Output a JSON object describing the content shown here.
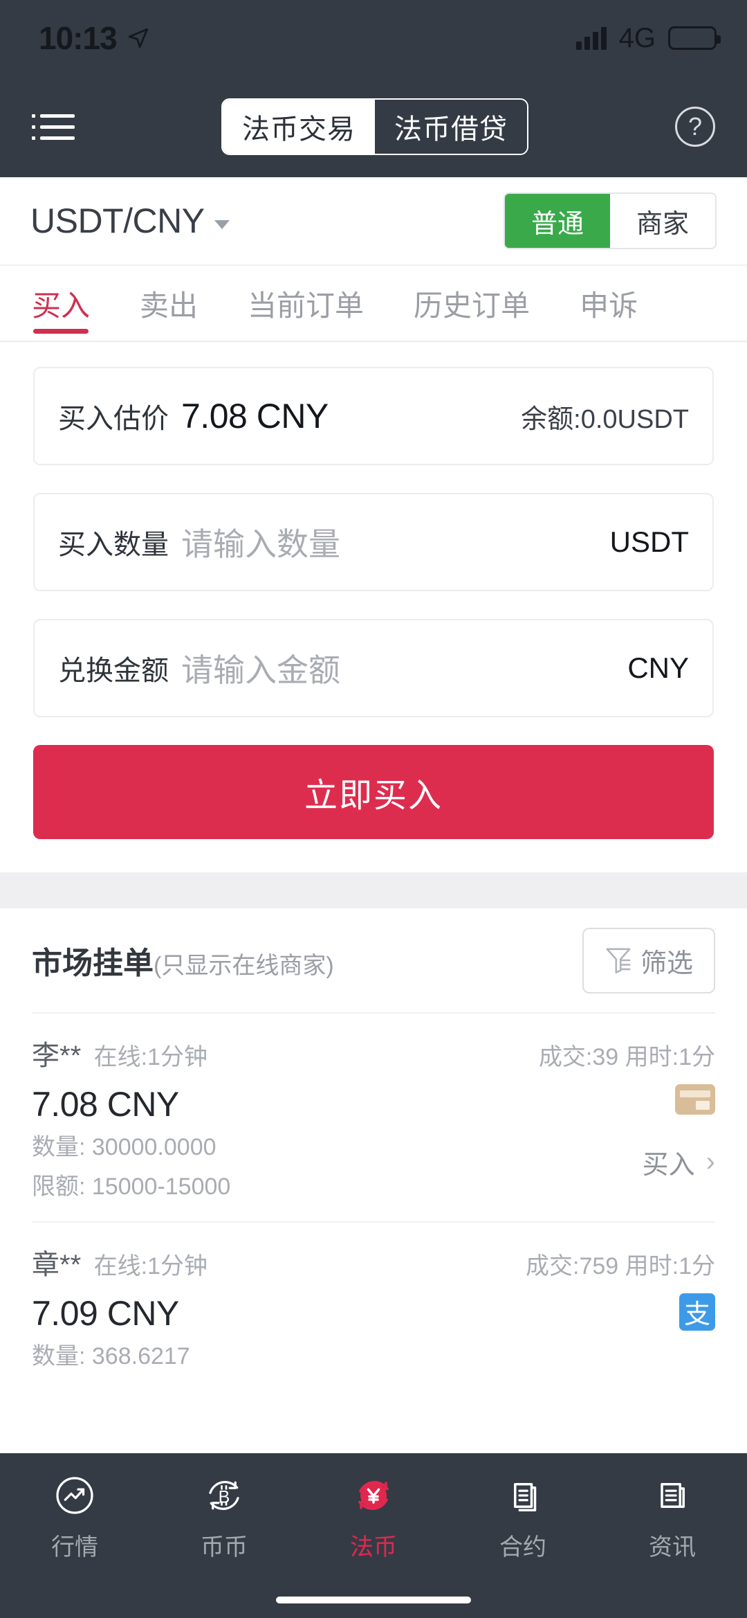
{
  "status_bar": {
    "time": "10:13",
    "location_icon": "location-arrow-icon",
    "network": "4G",
    "battery_level_pct": 30
  },
  "top_nav": {
    "menu_icon": "list-menu-icon",
    "help_icon": "help-circle-icon",
    "segments": [
      {
        "label": "法币交易",
        "active": true
      },
      {
        "label": "法币借贷",
        "active": false
      }
    ]
  },
  "pair_row": {
    "pair": "USDT/CNY",
    "dropdown_icon": "chevron-down-icon",
    "modes": [
      {
        "label": "普通",
        "active": true
      },
      {
        "label": "商家",
        "active": false
      }
    ]
  },
  "tabs": [
    {
      "label": "买入",
      "active": true
    },
    {
      "label": "卖出",
      "active": false
    },
    {
      "label": "当前订单",
      "active": false
    },
    {
      "label": "历史订单",
      "active": false
    },
    {
      "label": "申诉",
      "active": false
    }
  ],
  "form": {
    "price_row": {
      "label": "买入估价",
      "value": "7.08 CNY",
      "balance": "余额:0.0USDT"
    },
    "amount_row": {
      "label": "买入数量",
      "placeholder": "请输入数量",
      "unit": "USDT"
    },
    "fiat_row": {
      "label": "兑换金额",
      "placeholder": "请输入金额",
      "unit": "CNY"
    },
    "submit_label": "立即买入"
  },
  "market": {
    "title": "市场挂单",
    "subtitle": "(只显示在线商家)",
    "filter_label": "筛选",
    "filter_icon": "funnel-icon",
    "rows": [
      {
        "name": "李**",
        "online": "在线:1分钟",
        "stats": "成交:39 用时:1分",
        "price": "7.08 CNY",
        "amount": "数量: 30000.0000",
        "limit": "限额: 15000-15000",
        "pay_icon": "bank-card-icon",
        "action_label": "买入",
        "action_icon": "chevron-right-icon"
      },
      {
        "name": "章**",
        "online": "在线:1分钟",
        "stats": "成交:759 用时:1分",
        "price": "7.09 CNY",
        "amount": "数量: 368.6217",
        "limit": "",
        "pay_icon": "alipay-icon",
        "pay_glyph": "支",
        "action_label": "",
        "action_icon": ""
      }
    ]
  },
  "bottom_nav": [
    {
      "label": "行情",
      "icon": "market-trend-icon",
      "active": false
    },
    {
      "label": "币币",
      "icon": "bitcoin-exchange-icon",
      "active": false
    },
    {
      "label": "法币",
      "icon": "fiat-yuan-icon",
      "active": true
    },
    {
      "label": "合约",
      "icon": "contract-doc-icon",
      "active": false
    },
    {
      "label": "资讯",
      "icon": "news-doc-icon",
      "active": false
    }
  ],
  "colors": {
    "header_bg": "#343b45",
    "accent_red": "#cf3050",
    "buy_button": "#dd2d4f",
    "mode_green": "#3aa94a",
    "alipay_blue": "#3d9ae8",
    "card_tan": "#d9bd99"
  }
}
